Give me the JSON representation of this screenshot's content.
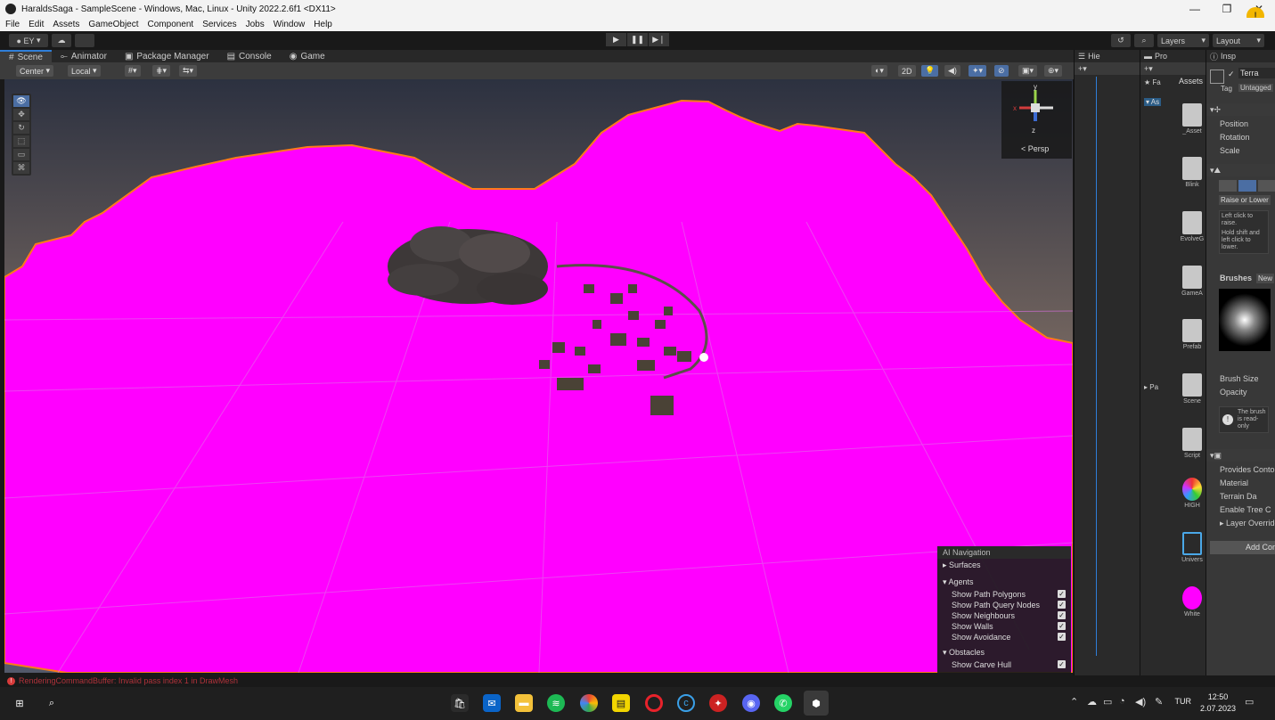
{
  "window": {
    "title": "HaraldsSaga - SampleScene - Windows, Mac, Linux - Unity 2022.2.6f1 <DX11>",
    "minimize": "—",
    "restore": "❐",
    "close": "✕",
    "notification": "!"
  },
  "menu": [
    "File",
    "Edit",
    "Assets",
    "GameObject",
    "Component",
    "Services",
    "Jobs",
    "Window",
    "Help"
  ],
  "toolbar": {
    "account": "EY",
    "layers": "Layers",
    "layout": "Layout"
  },
  "tabs": [
    {
      "label": "Scene",
      "icon": "#"
    },
    {
      "label": "Animator",
      "icon": "⟜"
    },
    {
      "label": "Package Manager",
      "icon": "▣"
    },
    {
      "label": "Console",
      "icon": "▤"
    },
    {
      "label": "Game",
      "icon": "◉"
    }
  ],
  "scene_toolbar": {
    "pivot": "Center",
    "space": "Local",
    "mode_2d": "2D"
  },
  "gizmo": {
    "persp": "Persp",
    "y": "y",
    "x": "x",
    "z": "z"
  },
  "nav_overlay": {
    "title": "AI Navigation",
    "surfaces": "Surfaces",
    "agents": "Agents",
    "agent_options": [
      "Show Path Polygons",
      "Show Path Query Nodes",
      "Show Neighbours",
      "Show Walls",
      "Show Avoidance"
    ],
    "obstacles": "Obstacles",
    "obstacle_options": [
      "Show Carve Hull"
    ],
    "check": "✓"
  },
  "hierarchy": {
    "tab": "Hie"
  },
  "project": {
    "tab": "Pro",
    "favorites": "Fa",
    "assets_header": "Assets",
    "assets_folder": "As",
    "packages": "Pa",
    "items": [
      "_Asset",
      "Blink",
      "EvolveG",
      "GameA",
      "Prefab",
      "Scene",
      "Script",
      "HIGH",
      "Univers",
      "White"
    ]
  },
  "inspector": {
    "tab": "Insp",
    "name": "Terra",
    "tag_label": "Tag",
    "tag_value": "Untagged",
    "position": "Position",
    "rotation": "Rotation",
    "scale": "Scale",
    "tool_dropdown": "Raise or Lower Terrain",
    "help_raise": "Left click to raise.",
    "help_lower": "Hold shift and left click to lower.",
    "brushes": "Brushes",
    "new_brush": "New",
    "brush_size": "Brush Size",
    "opacity": "Opacity",
    "readonly_note": "The brush is read-only",
    "provides_contours": "Provides Contours",
    "material": "Material",
    "terrain_data": "Terrain Da",
    "enable_tree": "Enable Tree C",
    "layer_overrides": "Layer Overrides",
    "add_component": "Add Component"
  },
  "status": {
    "error": "RenderingCommandBuffer: Invalid pass index 1 in DrawMesh"
  },
  "taskbar": {
    "language": "TUR",
    "time": "12:50",
    "date": "2.07.2023"
  },
  "colors": {
    "terrain": "#ff00ff",
    "selection_outline": "#ff7a1a",
    "accent": "#2f7ed8"
  }
}
